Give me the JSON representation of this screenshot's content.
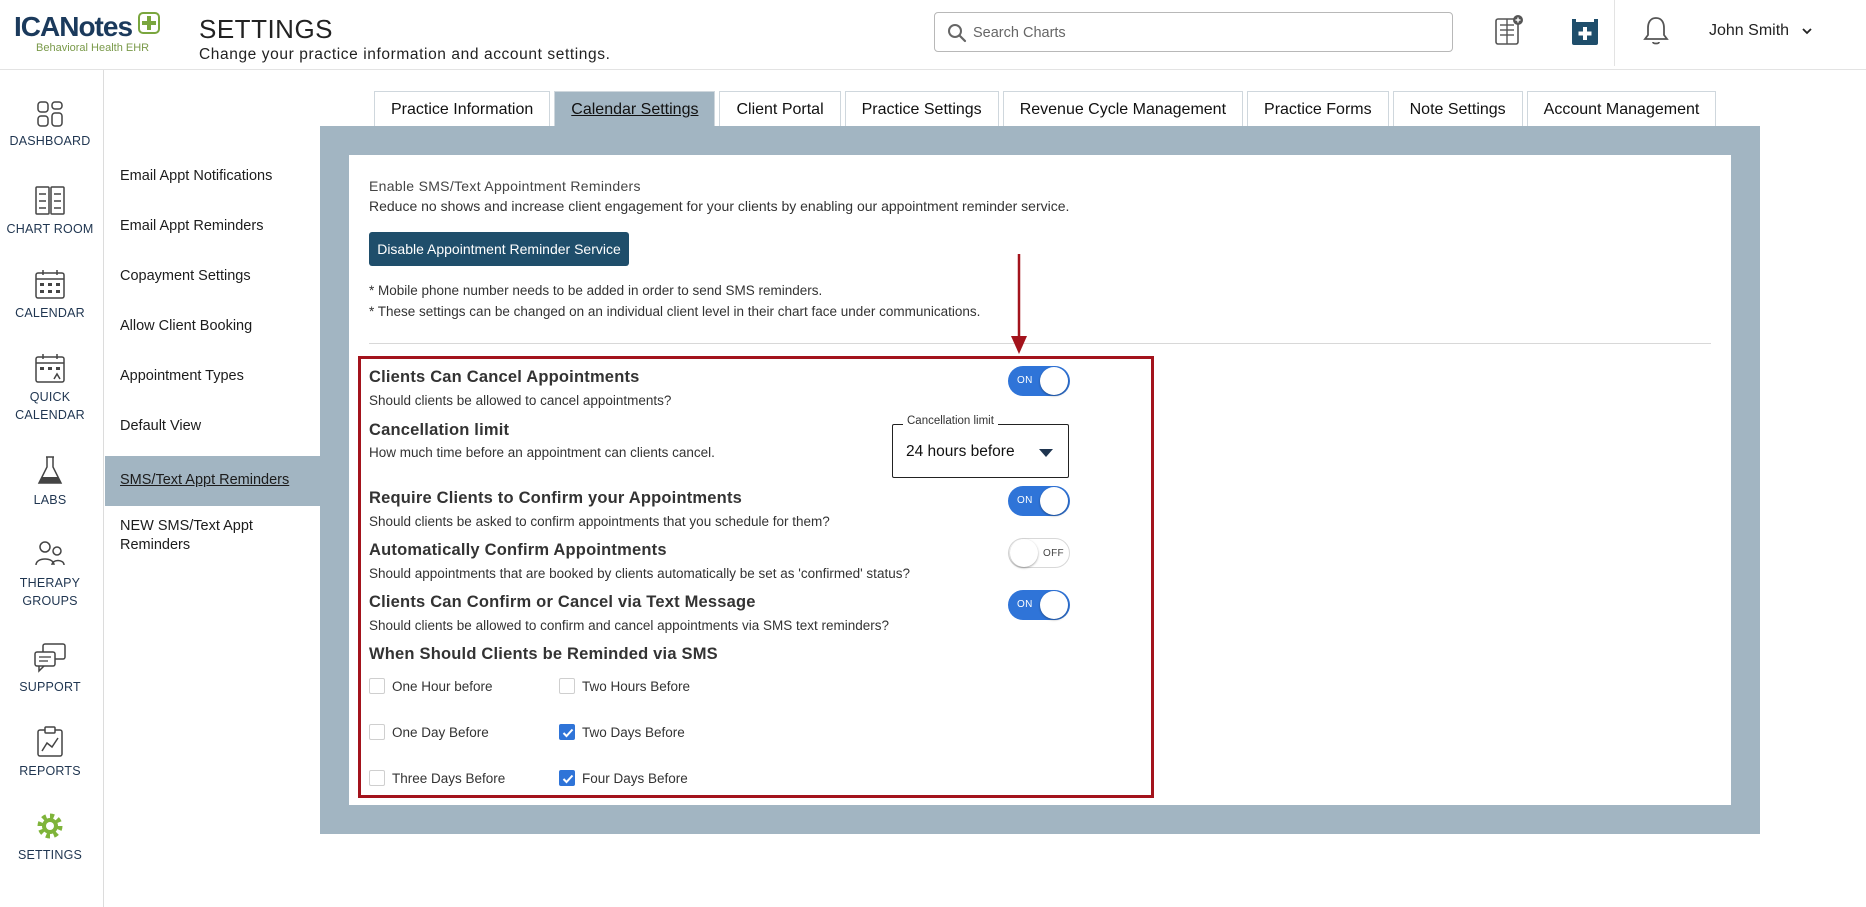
{
  "header": {
    "logo_brand": "ICANotes",
    "logo_sub": "Behavioral Health EHR",
    "title": "SETTINGS",
    "subtitle": "Change your practice information and account settings.",
    "search_placeholder": "Search Charts",
    "user_name": "John Smith"
  },
  "leftnav": [
    {
      "label": "DASHBOARD",
      "icon": "dashboard-icon"
    },
    {
      "label": "CHART ROOM",
      "icon": "chart-room-icon"
    },
    {
      "label": "CALENDAR",
      "icon": "calendar-icon"
    },
    {
      "label": "QUICK CALENDAR",
      "icon": "quick-calendar-icon"
    },
    {
      "label": "LABS",
      "icon": "labs-flask-icon"
    },
    {
      "label": "THERAPY GROUPS",
      "icon": "therapy-groups-icon"
    },
    {
      "label": "SUPPORT",
      "icon": "support-chat-icon"
    },
    {
      "label": "REPORTS",
      "icon": "reports-icon"
    },
    {
      "label": "SETTINGS",
      "icon": "settings-gear-icon"
    }
  ],
  "subnav": [
    {
      "label": "Email Appt Notifications"
    },
    {
      "label": "Email Appt Reminders"
    },
    {
      "label": "Copayment Settings"
    },
    {
      "label": "Allow Client Booking"
    },
    {
      "label": "Appointment Types"
    },
    {
      "label": "Default View"
    },
    {
      "label": "SMS/Text Appt Reminders",
      "active": true
    },
    {
      "label": "NEW SMS/Text Appt Reminders"
    }
  ],
  "tabs": [
    {
      "label": "Practice Information"
    },
    {
      "label": "Calendar Settings",
      "active": true
    },
    {
      "label": "Client Portal"
    },
    {
      "label": "Practice Settings"
    },
    {
      "label": "Revenue Cycle Management"
    },
    {
      "label": "Practice Forms"
    },
    {
      "label": "Note Settings"
    },
    {
      "label": "Account Management"
    }
  ],
  "sms": {
    "intro_title": "Enable SMS/Text Appointment Reminders",
    "intro_desc": "Reduce no shows and increase client engagement for your clients by enabling our appointment reminder service.",
    "disable_button": "Disable Appointment Reminder Service",
    "note_1": "* Mobile phone number needs to be added in order to send SMS reminders.",
    "note_2": "* These settings can be changed on an individual client level in their chart face under communications."
  },
  "settings": {
    "cancel": {
      "title": "Clients Can Cancel Appointments",
      "desc": "Should clients be allowed to cancel appointments?",
      "toggle": "ON"
    },
    "limit": {
      "title": "Cancellation limit",
      "desc": "How much time before an appointment can clients cancel.",
      "select_legend": "Cancellation limit",
      "select_value": "24 hours before"
    },
    "require_confirm": {
      "title": "Require Clients to Confirm your Appointments",
      "desc": "Should clients be asked to confirm appointments that you schedule for them?",
      "toggle": "ON"
    },
    "auto_confirm": {
      "title": "Automatically Confirm Appointments",
      "desc": "Should appointments that are booked by clients automatically be set as 'confirmed' status?",
      "toggle": "OFF"
    },
    "text_confirm": {
      "title": "Clients Can Confirm or Cancel via Text Message",
      "desc": "Should clients be allowed to confirm and cancel appointments via SMS text reminders?",
      "toggle": "ON"
    },
    "reminders": {
      "title": "When Should Clients be Reminded via SMS",
      "options": [
        {
          "label": "One Hour before",
          "checked": false
        },
        {
          "label": "Two Hours Before",
          "checked": false
        },
        {
          "label": "One Day Before",
          "checked": false
        },
        {
          "label": "Two Days Before",
          "checked": true
        },
        {
          "label": "Three Days Before",
          "checked": false
        },
        {
          "label": "Four Days Before",
          "checked": true
        }
      ]
    }
  },
  "colors": {
    "primary_button": "#1f4e6b",
    "toggle_on": "#2f74d8",
    "panel_frame": "#a2b5c2",
    "highlight_border": "#a3131c",
    "settings_icon": "#7fb43a"
  }
}
